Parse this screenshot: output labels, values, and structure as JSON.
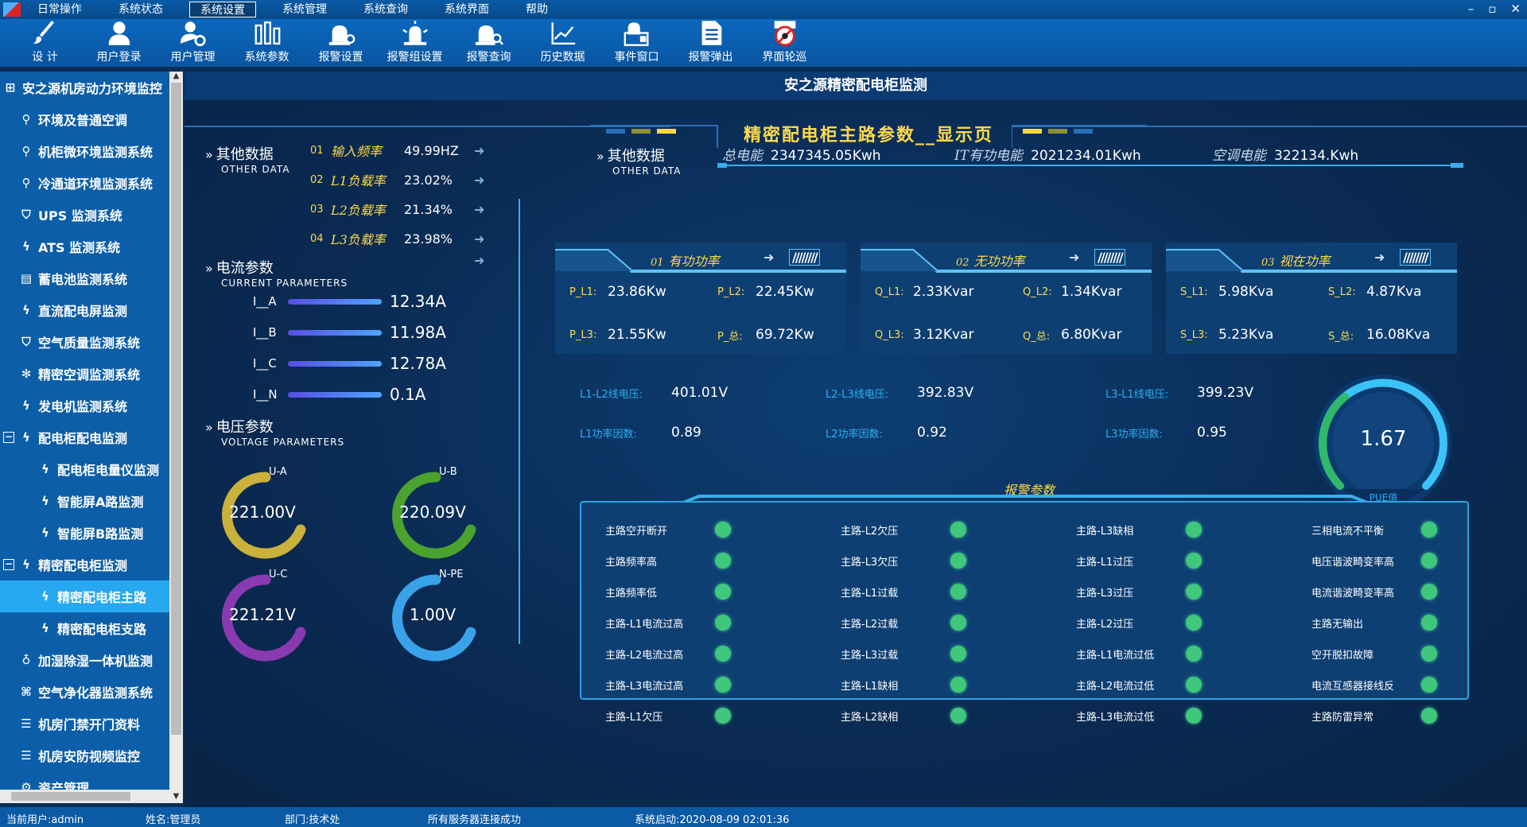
{
  "menu": [
    "日常操作",
    "系统状态",
    "系统设置",
    "系统管理",
    "系统查询",
    "系统界面",
    "帮助"
  ],
  "menu_active": "系统设置",
  "window_controls": [
    "–",
    "▫",
    "✕"
  ],
  "toolbar": [
    {
      "label": "设 计",
      "icon": "brush-icon"
    },
    {
      "label": "用户登录",
      "icon": "user-icon"
    },
    {
      "label": "用户管理",
      "icon": "user-gear-icon"
    },
    {
      "label": "系统参数",
      "icon": "params-icon"
    },
    {
      "label": "报警设置",
      "icon": "alarm-settings-icon"
    },
    {
      "label": "报警组设置",
      "icon": "alarm-group-icon"
    },
    {
      "label": "报警查询",
      "icon": "alarm-search-icon"
    },
    {
      "label": "历史数据",
      "icon": "history-chart-icon"
    },
    {
      "label": "事件窗口",
      "icon": "event-window-icon"
    },
    {
      "label": "报警弹出",
      "icon": "document-icon"
    },
    {
      "label": "界面轮巡",
      "icon": "patrol-icon"
    }
  ],
  "sidebar": {
    "items": [
      {
        "label": "安之源机房动力环境监控",
        "icon": "grid-icon",
        "indent": 0
      },
      {
        "label": "环境及普通空调",
        "icon": "sensor-icon",
        "indent": 1
      },
      {
        "label": "机柜微环境监测系统",
        "icon": "sensor-icon",
        "indent": 1
      },
      {
        "label": "冷通道环境监测系统",
        "icon": "sensor-icon",
        "indent": 1
      },
      {
        "label": "UPS 监测系统",
        "icon": "shield-icon",
        "indent": 1
      },
      {
        "label": "ATS 监测系统",
        "icon": "bolt-icon",
        "indent": 1
      },
      {
        "label": "蓄电池监测系统",
        "icon": "battery-icon",
        "indent": 1
      },
      {
        "label": "直流配电屏监测",
        "icon": "bolt-icon",
        "indent": 1
      },
      {
        "label": "空气质量监测系统",
        "icon": "shield-icon",
        "indent": 1
      },
      {
        "label": "精密空调监测系统",
        "icon": "snowflake-icon",
        "indent": 1
      },
      {
        "label": "发电机监测系统",
        "icon": "bolt-icon",
        "indent": 1
      },
      {
        "label": "配电柜配电监测",
        "icon": "bolt-icon",
        "indent": 0,
        "toggle": "⊟"
      },
      {
        "label": "配电柜电量仪监测",
        "icon": "bolt-icon",
        "indent": 2
      },
      {
        "label": "智能屏A路监测",
        "icon": "bolt-icon",
        "indent": 2
      },
      {
        "label": "智能屏B路监测",
        "icon": "bolt-icon",
        "indent": 2
      },
      {
        "label": "精密配电柜监测",
        "icon": "bolt-icon",
        "indent": 0,
        "toggle": "⊟"
      },
      {
        "label": "精密配电柜主路",
        "icon": "bolt-icon",
        "indent": 2,
        "active": true
      },
      {
        "label": "精密配电柜支路",
        "icon": "bolt-icon",
        "indent": 2
      },
      {
        "label": "加湿除湿一体机监测",
        "icon": "drop-icon",
        "indent": 1
      },
      {
        "label": "空气净化器监测系统",
        "icon": "purifier-icon",
        "indent": 1
      },
      {
        "label": "机房门禁开门资料",
        "icon": "list-icon",
        "indent": 1
      },
      {
        "label": "机房安防视频监控",
        "icon": "list-icon",
        "indent": 1
      },
      {
        "label": "资产管理",
        "icon": "gear-icon",
        "indent": 1
      }
    ]
  },
  "main": {
    "title": "安之源精密配电柜监测",
    "banner": "精密配电柜主路参数__显示页"
  },
  "other_data": {
    "title": "其他数据",
    "subtitle": "OTHER DATA",
    "rows": [
      {
        "num": "01",
        "label": "输入频率",
        "value": "49.99HZ"
      },
      {
        "num": "02",
        "label": "L1负载率",
        "value": "23.02%"
      },
      {
        "num": "03",
        "label": "L2负载率",
        "value": "21.34%"
      },
      {
        "num": "04",
        "label": "L3负载率",
        "value": "23.98%"
      }
    ]
  },
  "current": {
    "title": "电流参数",
    "subtitle": "CURRENT PARAMETERS",
    "rows": [
      {
        "label": "I__A",
        "value": "12.34A"
      },
      {
        "label": "I__B",
        "value": "11.98A"
      },
      {
        "label": "I__C",
        "value": "12.78A"
      },
      {
        "label": "I__N",
        "value": "0.1A"
      }
    ]
  },
  "voltage": {
    "title": "电压参数",
    "subtitle": "VOLTAGE PARAMETERS",
    "gauges": [
      {
        "label": "U-A",
        "value": "221.00V",
        "color": "#c9b13c"
      },
      {
        "label": "U-B",
        "value": "220.09V",
        "color": "#4aa22f"
      },
      {
        "label": "U-C",
        "value": "221.21V",
        "color": "#8a3ab0"
      },
      {
        "label": "N-PE",
        "value": "1.00V",
        "color": "#3aa2e8"
      }
    ]
  },
  "other_data2": {
    "title": "其他数据",
    "subtitle": "OTHER DATA",
    "items": [
      {
        "label": "总电能",
        "value": "2347345.05Kwh"
      },
      {
        "label": "IT有功电能",
        "value": "2021234.01Kwh"
      },
      {
        "label": "空调电能",
        "value": "322134.Kwh"
      }
    ]
  },
  "power_cards": [
    {
      "num": "01",
      "title": "有功功率",
      "cells": [
        {
          "k": "P_L1:",
          "v": "23.86Kw"
        },
        {
          "k": "P_L2:",
          "v": "22.45Kw"
        },
        {
          "k": "P_L3:",
          "v": "21.55Kw"
        },
        {
          "k": "P_总:",
          "v": "69.72Kw"
        }
      ]
    },
    {
      "num": "02",
      "title": "无功功率",
      "cells": [
        {
          "k": "Q_L1:",
          "v": "2.33Kvar"
        },
        {
          "k": "Q_L2:",
          "v": "1.34Kvar"
        },
        {
          "k": "Q_L3:",
          "v": "3.12Kvar"
        },
        {
          "k": "Q_总:",
          "v": "6.80Kvar"
        }
      ]
    },
    {
      "num": "03",
      "title": "视在功率",
      "cells": [
        {
          "k": "S_L1:",
          "v": "5.98Kva"
        },
        {
          "k": "S_L2:",
          "v": "4.87Kva"
        },
        {
          "k": "S_L3:",
          "v": "5.23Kva"
        },
        {
          "k": "S_总:",
          "v": "16.08Kva"
        }
      ]
    }
  ],
  "line_values": [
    {
      "k": "L1-L2线电压:",
      "v": "401.01V"
    },
    {
      "k": "L2-L3线电压:",
      "v": "392.83V"
    },
    {
      "k": "L3-L1线电压:",
      "v": "399.23V"
    },
    {
      "k": "L1功率因数:",
      "v": "0.89"
    },
    {
      "k": "L2功率因数:",
      "v": "0.92"
    },
    {
      "k": "L3功率因数:",
      "v": "0.95"
    }
  ],
  "pue": {
    "value": "1.67",
    "label": "PUE值"
  },
  "alarms": {
    "title": "报警参数",
    "columns": [
      [
        "主路空开断开",
        "主路频率高",
        "主路频率低",
        "主路-L1电流过高",
        "主路-L2电流过高",
        "主路-L3电流过高",
        "主路-L1欠压"
      ],
      [
        "主路-L2欠压",
        "主路-L3欠压",
        "主路-L1过载",
        "主路-L2过载",
        "主路-L3过载",
        "主路-L1缺相",
        "主路-L2缺相"
      ],
      [
        "主路-L3缺相",
        "主路-L1过压",
        "主路-L3过压",
        "主路-L2过压",
        "主路-L1电流过低",
        "主路-L2电流过低",
        "主路-L3电流过低"
      ],
      [
        "三相电流不平衡",
        "电压谐波畸变率高",
        "电流谐波畸变率高",
        "主路无输出",
        "空开脱扣故障",
        "电流互感器接线反",
        "主路防雷异常"
      ]
    ],
    "status_color": "#3fc77c"
  },
  "status": {
    "user": "当前用户:admin",
    "name": "姓名:管理员",
    "dept": "部门:技术处",
    "conn": "所有服务器连接成功",
    "start": "系统启动:2020-08-09 02:01:36"
  }
}
